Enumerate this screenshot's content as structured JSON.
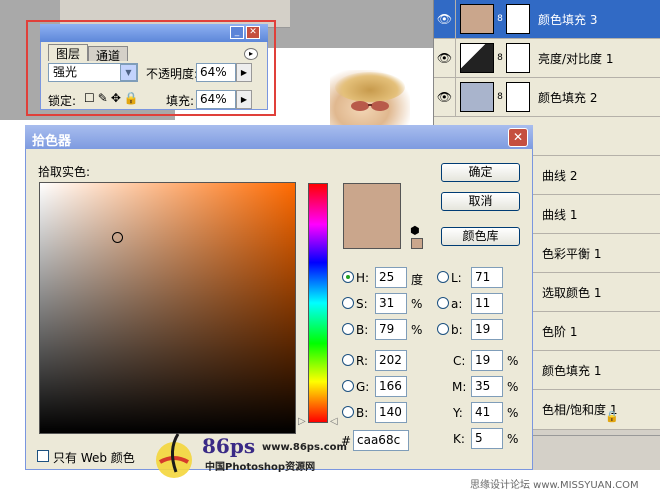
{
  "layers": [
    {
      "name": "颜色填充 3",
      "thumb": "#caa68c",
      "selected": true
    },
    {
      "name": "亮度/对比度 1",
      "thumb": "#222222",
      "selected": false
    },
    {
      "name": "颜色填充 2",
      "thumb": "#a9b4cc",
      "selected": false
    },
    {
      "name": "曲线 2"
    },
    {
      "name": "曲线 1"
    },
    {
      "name": "色彩平衡 1"
    },
    {
      "name": "选取颜色 1"
    },
    {
      "name": "色阶 1"
    },
    {
      "name": "颜色填充 1"
    },
    {
      "name": "色相/饱和度 1"
    }
  ],
  "layer_options": {
    "tab_layers": "图层",
    "tab_channels": "通道",
    "blend_mode": "强光",
    "opacity_label": "不透明度:",
    "opacity": "64%",
    "lock_label": "锁定:",
    "fill_label": "填充:",
    "fill": "64%"
  },
  "picker": {
    "title": "拾色器",
    "pick_label": "拾取实色:",
    "ok": "确定",
    "cancel": "取消",
    "libraries": "颜色库",
    "current_color": "#caa68c",
    "fields": {
      "H": {
        "label": "H:",
        "value": "25",
        "unit": "度"
      },
      "S": {
        "label": "S:",
        "value": "31",
        "unit": "%"
      },
      "Bv": {
        "label": "B:",
        "value": "79",
        "unit": "%"
      },
      "R": {
        "label": "R:",
        "value": "202"
      },
      "G": {
        "label": "G:",
        "value": "166"
      },
      "Bc": {
        "label": "B:",
        "value": "140"
      },
      "L": {
        "label": "L:",
        "value": "71"
      },
      "a": {
        "label": "a:",
        "value": "11"
      },
      "b": {
        "label": "b:",
        "value": "19"
      },
      "C": {
        "label": "C:",
        "value": "19",
        "unit": "%"
      },
      "M": {
        "label": "M:",
        "value": "35",
        "unit": "%"
      },
      "Y": {
        "label": "Y:",
        "value": "41",
        "unit": "%"
      },
      "K": {
        "label": "K:",
        "value": "5",
        "unit": "%"
      }
    },
    "hex_label": "#",
    "hex": "caa68c",
    "web_only": "只有 Web 颜色"
  },
  "watermark": {
    "brand": "86ps",
    "url": "www.86ps.com",
    "site_cn": "中国Photoshop资源网",
    "corner": "思缘设计论坛  www.MISSYUAN.COM"
  },
  "icons": {
    "eye": "eye-icon",
    "chain": "chain-link-icon",
    "lock": "lock-icon",
    "cube": "web-safe-cube-icon",
    "close": "close-icon"
  }
}
